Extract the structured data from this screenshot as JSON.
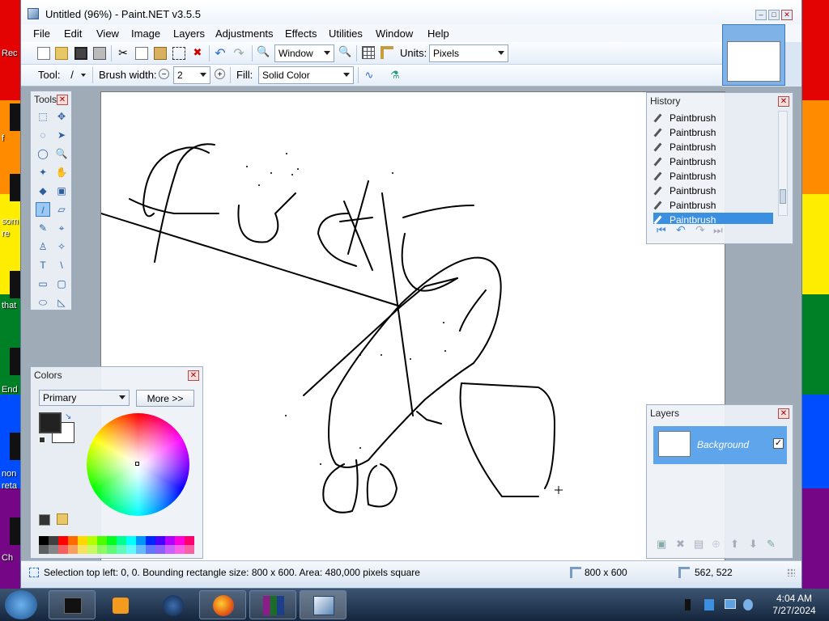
{
  "desktop": {
    "snippets": [
      "Rec",
      "f",
      "som",
      "re",
      "that",
      "End",
      "non",
      "reta",
      "Ch"
    ]
  },
  "window": {
    "title": "Untitled (96%) - Paint.NET v3.5.5",
    "controls": {
      "minimize": "–",
      "maximize": "□",
      "close": "✕"
    }
  },
  "menu": [
    "File",
    "Edit",
    "View",
    "Image",
    "Layers",
    "Adjustments",
    "Effects",
    "Utilities",
    "Window",
    "Help"
  ],
  "toolbar": {
    "zoom_value": "Window",
    "units_label": "Units:",
    "units_value": "Pixels",
    "tool_label": "Tool:",
    "brush_width_label": "Brush width:",
    "brush_width_value": "2",
    "fill_label": "Fill:",
    "fill_value": "Solid Color"
  },
  "tools_panel": {
    "title": "Tools",
    "close": "✕",
    "icons": [
      "rectangle-select-icon",
      "move-selection-icon",
      "lasso-select-icon",
      "move-selected-icon",
      "ellipse-select-icon",
      "zoom-icon",
      "magic-wand-icon",
      "pan-icon",
      "paint-bucket-icon",
      "gradient-icon",
      "paintbrush-icon",
      "eraser-icon",
      "pencil-icon",
      "color-picker-icon",
      "clone-stamp-icon",
      "recolor-icon",
      "text-icon",
      "line-curve-icon",
      "rectangle-icon",
      "rounded-rectangle-icon",
      "ellipse-icon",
      "freeform-shape-icon"
    ],
    "glyphs": [
      "⬚",
      "✥",
      "◌",
      "➤",
      "◯",
      "🔍",
      "✦",
      "✋",
      "◆",
      "▣",
      "/",
      "▱",
      "✎",
      "⌖",
      "♙",
      "✧",
      "T",
      "\\",
      "▭",
      "▢",
      "⬭",
      "◺"
    ]
  },
  "history_panel": {
    "title": "History",
    "close": "✕",
    "items": [
      "Paintbrush",
      "Paintbrush",
      "Paintbrush",
      "Paintbrush",
      "Paintbrush",
      "Paintbrush",
      "Paintbrush",
      "Paintbrush"
    ],
    "selected_index": 7
  },
  "colors_panel": {
    "title": "Colors",
    "close": "✕",
    "mode": "Primary",
    "more_button": "More >>",
    "primary_color": "#222222",
    "secondary_color": "#ffffff",
    "palette": [
      "#000000",
      "#404040",
      "#ff0000",
      "#ff6a00",
      "#ffd800",
      "#b6ff00",
      "#4cff00",
      "#00ff21",
      "#00ff90",
      "#00ffff",
      "#0094ff",
      "#0026ff",
      "#4800ff",
      "#b200ff",
      "#ff00dc",
      "#ff006e"
    ]
  },
  "layers_panel": {
    "title": "Layers",
    "close": "✕",
    "layer_name": "Background",
    "layer_visible": true
  },
  "status": {
    "selection_info": "Selection top left: 0, 0. Bounding rectangle size: 800 x 600. Area: 480,000 pixels square",
    "image_size": "800 x 600",
    "cursor_pos": "562, 522"
  },
  "taskbar": {
    "time": "4:04 AM",
    "date": "7/27/2024",
    "apps": [
      "terminal-icon",
      "media-player-icon",
      "globe-icon",
      "firefox-icon",
      "winrar-icon",
      "paintnet-icon"
    ]
  }
}
